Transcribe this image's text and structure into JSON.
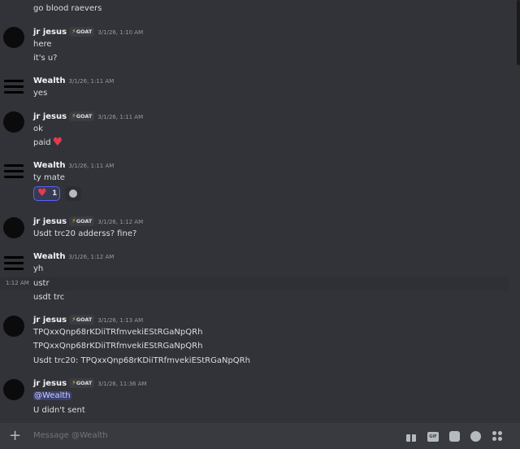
{
  "messages": [
    {
      "text": "go blood raevers"
    },
    {
      "author": "jr jesus",
      "badge": "GOAT",
      "time": "3/1/26, 1:10 AM",
      "lines": [
        "here",
        "it's u?"
      ]
    },
    {
      "author": "Wealth",
      "time": "3/1/26, 1:11 AM",
      "lines": [
        "yes"
      ]
    },
    {
      "author": "jr jesus",
      "badge": "GOAT",
      "time": "3/1/26, 1:11 AM",
      "lines": [
        "ok",
        "paid"
      ]
    },
    {
      "author": "Wealth",
      "time": "3/1/26, 1:11 AM",
      "lines": [
        "ty mate"
      ],
      "reaction": {
        "emoji": "heart",
        "count": "1"
      }
    },
    {
      "author": "jr jesus",
      "badge": "GOAT",
      "time": "3/1/26, 1:12 AM",
      "lines": [
        "Usdt trc20 adderss? fine?"
      ]
    },
    {
      "author": "Wealth",
      "time": "3/1/26, 1:12 AM",
      "lines": [
        "yh",
        "ustr",
        "usdt trc"
      ],
      "hover_time": "1:12 AM"
    },
    {
      "author": "jr jesus",
      "badge": "GOAT",
      "time": "3/1/26, 1:13 AM",
      "lines": [
        "TPQxxQnp68rKDiiTRfmvekiEStRGaNpQRh",
        "TPQxxQnp68rKDiiTRfmvekiEStRGaNpQRh",
        "Usdt trc20: TPQxxQnp68rKDiiTRfmvekiEStRGaNpQRh"
      ]
    },
    {
      "author": "jr jesus",
      "badge": "GOAT",
      "time": "3/1/26, 11:36 AM",
      "mention": "@Wealth",
      "lines": [
        "U didn't sent"
      ]
    }
  ],
  "composer": {
    "placeholder": "Message @Wealth",
    "gif_label": "GIF"
  },
  "colors": {
    "accent": "#5865f2",
    "heart": "#e23b4f",
    "badge_bolt": "#f0b232"
  }
}
